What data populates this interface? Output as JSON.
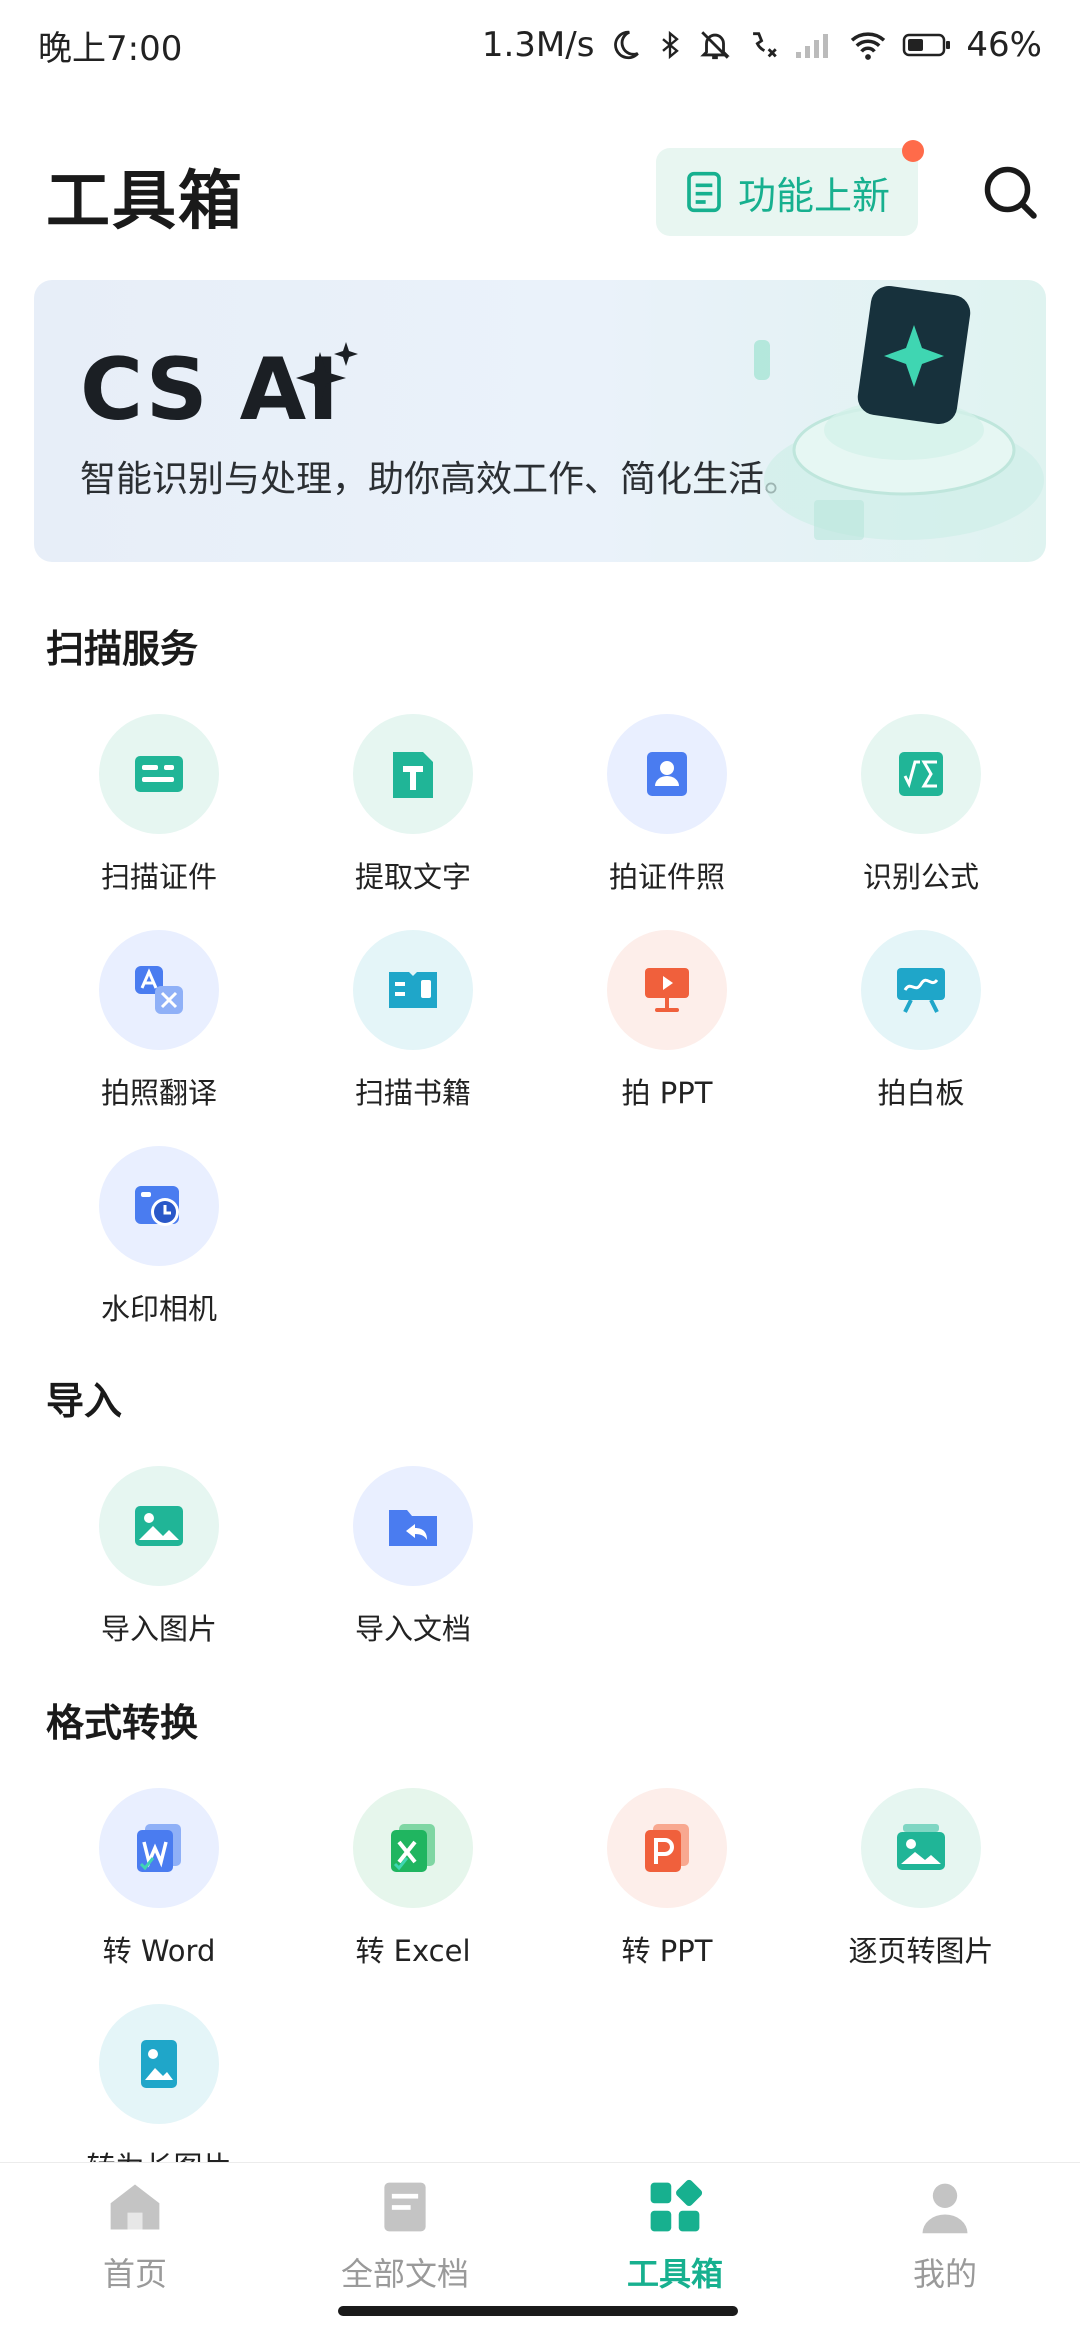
{
  "status_bar": {
    "time": "晚上7:00",
    "net_speed": "1.3M/s",
    "battery": "46%"
  },
  "header": {
    "title": "工具箱",
    "whats_new_label": "功能上新"
  },
  "banner": {
    "title": "CS AI",
    "subtitle": "智能识别与处理，助你高效工作、简化生活。"
  },
  "sections": {
    "scan": {
      "title": "扫描服务",
      "items": [
        {
          "label": "扫描证件",
          "icon": "id-card-icon",
          "color": "#20b597",
          "bg": "#e6f6f1"
        },
        {
          "label": "提取文字",
          "icon": "text-extract-icon",
          "color": "#20b597",
          "bg": "#e6f6f1"
        },
        {
          "label": "拍证件照",
          "icon": "id-photo-icon",
          "color": "#4a7cf0",
          "bg": "#e9efff"
        },
        {
          "label": "识别公式",
          "icon": "formula-icon",
          "color": "#20b597",
          "bg": "#e6f6f1"
        },
        {
          "label": "拍照翻译",
          "icon": "translate-icon",
          "color": "#4a7cf0",
          "bg": "#e9efff"
        },
        {
          "label": "扫描书籍",
          "icon": "book-icon",
          "color": "#1fa6c9",
          "bg": "#e4f5f8"
        },
        {
          "label": "拍 PPT",
          "icon": "presentation-icon",
          "color": "#f0603c",
          "bg": "#fdeeea"
        },
        {
          "label": "拍白板",
          "icon": "whiteboard-icon",
          "color": "#1fa6c9",
          "bg": "#e4f5f8"
        },
        {
          "label": "水印相机",
          "icon": "watermark-camera-icon",
          "color": "#4a7cf0",
          "bg": "#e9efff"
        }
      ]
    },
    "import": {
      "title": "导入",
      "items": [
        {
          "label": "导入图片",
          "icon": "image-icon",
          "color": "#20b597",
          "bg": "#e6f6f1"
        },
        {
          "label": "导入文档",
          "icon": "folder-import-icon",
          "color": "#4a7cf0",
          "bg": "#e9efff"
        }
      ]
    },
    "convert": {
      "title": "格式转换",
      "items": [
        {
          "label": "转 Word",
          "icon": "word-icon",
          "color": "#4a7cf0",
          "bg": "#e9efff"
        },
        {
          "label": "转 Excel",
          "icon": "excel-icon",
          "color": "#20b560",
          "bg": "#e6f6ec"
        },
        {
          "label": "转 PPT",
          "icon": "ppt-icon",
          "color": "#f0603c",
          "bg": "#fdeeea"
        },
        {
          "label": "逐页转图片",
          "icon": "pages-to-image-icon",
          "color": "#20b597",
          "bg": "#e6f6f1"
        },
        {
          "label": "转为长图片",
          "icon": "long-image-icon",
          "color": "#1fa6c9",
          "bg": "#e4f5f8"
        }
      ]
    }
  },
  "bottom_nav": {
    "items": [
      {
        "label": "首页",
        "icon": "home-icon"
      },
      {
        "label": "全部文档",
        "icon": "documents-icon"
      },
      {
        "label": "工具箱",
        "icon": "toolbox-icon",
        "active": true
      },
      {
        "label": "我的",
        "icon": "profile-icon"
      }
    ]
  },
  "colors": {
    "accent": "#17b08f",
    "notification_dot": "#ff6b4a"
  }
}
